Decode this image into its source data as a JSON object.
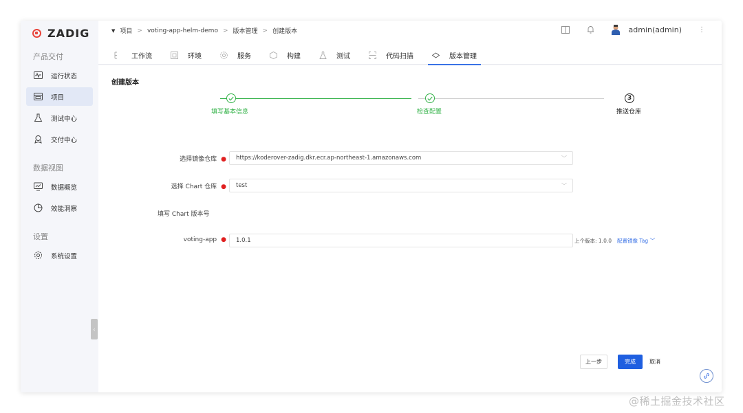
{
  "app": {
    "logo_text": "ZADIG",
    "brand_color": "#e8453c",
    "accent_color": "#3a72e6",
    "success_color": "#35b34a"
  },
  "sidebar": {
    "groups": [
      {
        "label": "产品交付"
      },
      {
        "label": "数据视图"
      },
      {
        "label": "设置"
      }
    ],
    "items": [
      {
        "label": "运行状态",
        "icon": "pulse-icon"
      },
      {
        "label": "项目",
        "icon": "project-icon"
      },
      {
        "label": "测试中心",
        "icon": "flask-icon"
      },
      {
        "label": "交付中心",
        "icon": "delivery-icon"
      },
      {
        "label": "数据概览",
        "icon": "dashboard-icon"
      },
      {
        "label": "效能洞察",
        "icon": "pie-chart-icon"
      },
      {
        "label": "系统设置",
        "icon": "gear-icon"
      }
    ],
    "collapse_glyph": "‹"
  },
  "header": {
    "breadcrumb": [
      "项目",
      "voting-app-helm-demo",
      "版本管理",
      "创建版本"
    ],
    "user": "admin(admin)",
    "tabs": [
      {
        "label": "工作流",
        "icon": "workflow-icon"
      },
      {
        "label": "环境",
        "icon": "environment-icon"
      },
      {
        "label": "服务",
        "icon": "service-icon"
      },
      {
        "label": "构建",
        "icon": "build-icon"
      },
      {
        "label": "测试",
        "icon": "test-icon"
      },
      {
        "label": "代码扫描",
        "icon": "scan-icon"
      },
      {
        "label": "版本管理",
        "icon": "version-icon"
      }
    ]
  },
  "page": {
    "title": "创建版本",
    "steps": [
      {
        "label": "填写基本信息",
        "status": "done"
      },
      {
        "label": "检查配置",
        "status": "done"
      },
      {
        "label": "推送仓库",
        "status": "current",
        "number": "3"
      }
    ],
    "form": {
      "image_repo_label": "选择镜像仓库",
      "image_repo_value": "https://koderover-zadig.dkr.ecr.ap-northeast-1.amazonaws.com",
      "chart_repo_label": "选择 Chart 仓库",
      "chart_repo_value": "test",
      "chart_version_heading": "填写 Chart 版本号",
      "service_label": "voting-app",
      "service_version": "1.0.1",
      "prev_version_text": "上个版本: 1.0.0",
      "config_tag_link": "配置镜像 Tag"
    },
    "buttons": {
      "prev": "上一步",
      "done": "完成",
      "cancel": "取消"
    }
  },
  "watermark": "@稀土掘金技术社区"
}
